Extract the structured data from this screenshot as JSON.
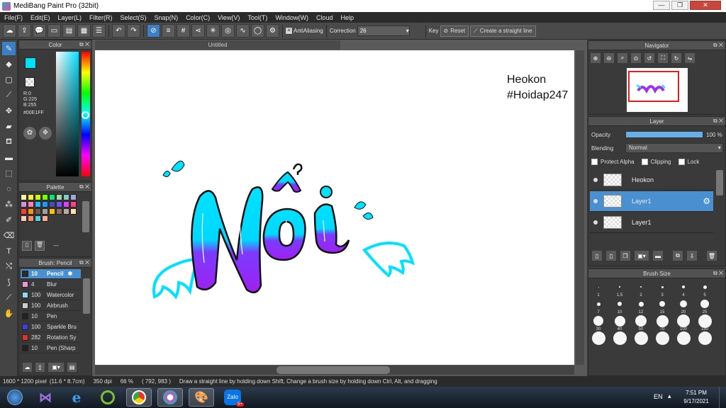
{
  "window": {
    "title": "MediBang Paint Pro (32bit)",
    "min": "—",
    "max": "❐",
    "close": "✕"
  },
  "menu": [
    "File(F)",
    "Edit(E)",
    "Layer(L)",
    "Filter(R)",
    "Select(S)",
    "Snap(N)",
    "Color(C)",
    "View(V)",
    "Tool(T)",
    "Window(W)",
    "Cloud",
    "Help"
  ],
  "toolbar": {
    "antialias_label": "AntiAliasing",
    "correction_label": "Correction",
    "correction_value": "26",
    "key_label": "Key",
    "reset_label": "Reset",
    "straight_line_label": "Create a straight line"
  },
  "color_panel": {
    "title": "Color",
    "r": "R:0",
    "g": "G:225",
    "b": "B:255",
    "hex": "#00E1FF",
    "primary": "#00e1ff",
    "secondary": "#ff7a00"
  },
  "palette_panel": {
    "title": "Palette",
    "footer_text": "---",
    "colors": [
      "#fff59d",
      "#ffeb3b",
      "#c6ff00",
      "#76ff03",
      "#00e676",
      "#a5d6a7",
      "#80cbc4",
      "#9fa8da",
      "#ce93d8",
      "#ff80ab",
      "#29b6f6",
      "#2196f3",
      "#3f51b5",
      "#7c4dff",
      "#e040fb",
      "#ff4081",
      "#f44336",
      "#ff9800",
      "#795548",
      "#9e9e9e",
      "#ffc107",
      "#8d6e63",
      "#bcaaa4",
      "#ffe0b2",
      "#ffccbc",
      "#ff8a65",
      "#4dd0e1",
      "#ffab91"
    ]
  },
  "brush_panel": {
    "title": "Brush: Pencil",
    "items": [
      {
        "size": "10",
        "name": "Pencil",
        "color": "#2b2b2b",
        "selected": true
      },
      {
        "size": "4",
        "name": "Blur",
        "color": "#e89ad8",
        "selected": false
      },
      {
        "size": "100",
        "name": "Watercolor",
        "color": "#8fd8f0",
        "selected": false
      },
      {
        "size": "100",
        "name": "Airbrush",
        "color": "#cccccc",
        "selected": false
      },
      {
        "size": "10",
        "name": "Pen",
        "color": "#222222",
        "selected": false
      },
      {
        "size": "100",
        "name": "Sparkle Bru",
        "color": "#4040e0",
        "selected": false
      },
      {
        "size": "282",
        "name": "Rotation Sy",
        "color": "#e03030",
        "selected": false
      },
      {
        "size": "10",
        "name": "Pen (Sharp",
        "color": "#222222",
        "selected": false
      }
    ]
  },
  "canvas": {
    "tab_title": "Untitled",
    "watermark_line1": "Heokon",
    "watermark_line2": "#Hoidap247",
    "art_word": "Nồi"
  },
  "navigator": {
    "title": "Navigator"
  },
  "layer_panel": {
    "title": "Layer",
    "opacity_label": "Opacity",
    "opacity_value": "100 %",
    "opacity_fraction": 1.0,
    "blending_label": "Blending",
    "blending_value": "Normal",
    "protect_alpha_label": "Protect Alpha",
    "clipping_label": "Clipping",
    "lock_label": "Lock",
    "layers": [
      {
        "name": "Heokon",
        "selected": false
      },
      {
        "name": "Layer1",
        "selected": true
      },
      {
        "name": "Layer1",
        "selected": false
      }
    ]
  },
  "brush_size_panel": {
    "title": "Brush Size",
    "rows": [
      [
        "1",
        "1.5",
        "2",
        "3",
        "4",
        "5"
      ],
      [
        "7",
        "10",
        "12",
        "15",
        "20",
        "25"
      ],
      [
        "30",
        "40",
        "50",
        "70",
        "100",
        "150"
      ],
      [
        "",
        "",
        "",
        "",
        "",
        ""
      ]
    ]
  },
  "status": {
    "pixel": "1600 * 1200 pixel",
    "cm": "(11.6 * 8.7cm)",
    "dpi": "350 dpi",
    "zoom": "66 %",
    "coords": "( 792, 983 )",
    "hint": "Draw a straight line by holding down Shift, Change a brush size by holding down Ctrl, Alt, and dragging"
  },
  "taskbar": {
    "lang": "EN",
    "time": "7:51 PM",
    "date": "9/17/2021",
    "zalo_label": "Zalo",
    "zalo_badge": "5+"
  }
}
